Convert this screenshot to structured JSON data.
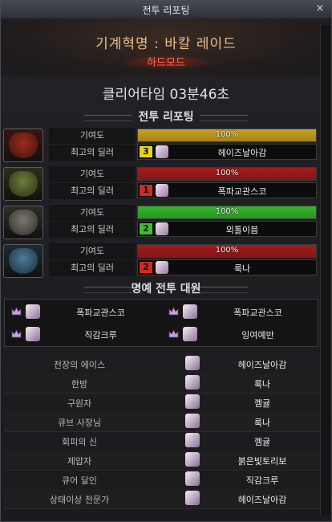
{
  "window": {
    "title": "전투 리포팅",
    "close_label": "×"
  },
  "header": {
    "raid_title": "기계혁명 : 바칼 레이드",
    "mode": "하드모드"
  },
  "clear_time": "클리어타임  03분46초",
  "report_section": {
    "title": "전투 리포팅"
  },
  "bosses": [
    {
      "icon": "red-mech-boss-icon",
      "color_a": "#9c2b1c",
      "color_b": "#3a1410",
      "contribution_label": "기여도",
      "contribution_text": "100%",
      "contribution": 1.0,
      "bar_color": "#c9a11e",
      "dealer_label": "최고의 딜러",
      "rank": "3",
      "badge_color": "#e8d21b",
      "dealer": "헤이즈날아감"
    },
    {
      "icon": "green-mech-boss-icon",
      "color_a": "#6b7d3a",
      "color_b": "#2a2f17",
      "contribution_label": "기여도",
      "contribution_text": "100%",
      "contribution": 1.0,
      "bar_color": "#a21b1b",
      "dealer_label": "최고의 딜러",
      "rank": "1",
      "badge_color": "#d22a22",
      "dealer": "폭파교관스코"
    },
    {
      "icon": "gray-mech-boss-icon",
      "color_a": "#7c776c",
      "color_b": "#2e2c28",
      "contribution_label": "기여도",
      "contribution_text": "100%",
      "contribution": 1.0,
      "bar_color": "#35b52a",
      "dealer_label": "최고의 딜러",
      "rank": "2",
      "badge_color": "#3bbf2a",
      "dealer": "외톨이븜"
    },
    {
      "icon": "blue-mech-boss-icon",
      "color_a": "#4b7c9c",
      "color_b": "#1c2b38",
      "contribution_label": "기여도",
      "contribution_text": "100%",
      "contribution": 1.0,
      "bar_color": "#a21b1b",
      "dealer_label": "최고의 딜러",
      "rank": "2",
      "badge_color": "#d22a22",
      "dealer": "룩나"
    }
  ],
  "honor_section": {
    "title": "명예 전투 대원"
  },
  "honor": [
    {
      "icon": "crown-icon",
      "name": "폭파교관스코"
    },
    {
      "icon": "crown-icon",
      "name": "폭파교관스코"
    },
    {
      "icon": "crown-icon",
      "name": "직감크루"
    },
    {
      "icon": "crown-icon",
      "name": "잉여예반"
    }
  ],
  "awards": [
    {
      "award": "전장의 에이스",
      "player": "헤이즈날아감"
    },
    {
      "award": "한방",
      "player": "룩나"
    },
    {
      "award": "구원자",
      "player": "껨귤"
    },
    {
      "award": "큐브 사장님",
      "player": "룩나"
    },
    {
      "award": "회피의 신",
      "player": "껨귤"
    },
    {
      "award": "제압자",
      "player": "붉은빛토리보"
    },
    {
      "award": "큐어 달인",
      "player": "직감크루"
    },
    {
      "award": "상태이상 전문가",
      "player": "헤이즈날아감"
    }
  ]
}
